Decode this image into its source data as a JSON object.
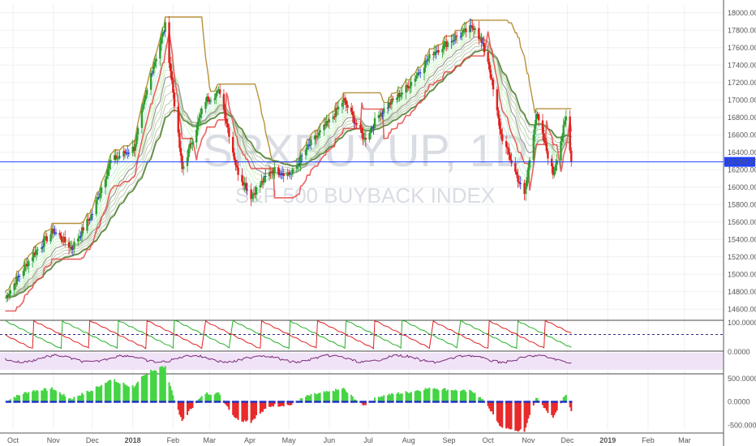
{
  "watermark": {
    "symbol": "SPXBUYUP, 1D",
    "name": "S&P 500 BUYBACK INDEX"
  },
  "colors": {
    "up": "#2e9e2e",
    "down": "#e0201e",
    "neutral": "#1f2fd6",
    "level_line": "#2040ff",
    "gold": "#b8913a",
    "red_trail": "#e84545",
    "ribbon_green": "#3c9a3c",
    "grid": "#eef0f3",
    "panel_border": "#444444"
  },
  "price_axis": {
    "ticks": [
      "18000.00",
      "17800.00",
      "17600.00",
      "17400.00",
      "17200.00",
      "17000.00",
      "16800.00",
      "16600.00",
      "16400.00",
      "16200.00",
      "16000.00",
      "15800.00",
      "15600.00",
      "15400.00",
      "15200.00",
      "15000.00",
      "14800.00",
      "14600.00"
    ],
    "last_price_label": "16289.25"
  },
  "osc1_axis": {
    "ticks": [
      "100.0000"
    ]
  },
  "osc2_axis": {
    "ticks": [
      "0.0000"
    ]
  },
  "osc3_axis": {
    "ticks": [
      "500.0000",
      "0.0000",
      "-500.0000"
    ]
  },
  "time_axis": {
    "labels": [
      "Oct",
      "Nov",
      "Dec",
      "2018",
      "Feb",
      "Mar",
      "Apr",
      "May",
      "Jun",
      "Jul",
      "Aug",
      "Sep",
      "Oct",
      "Nov",
      "Dec",
      "2019",
      "Feb",
      "Mar"
    ]
  },
  "chart_data": {
    "type": "candlestick",
    "title": "SPXBUYUP, 1D",
    "subtitle": "S&P 500 BUYBACK INDEX",
    "last_price": 16289.25,
    "ylim": [
      14500,
      18100
    ],
    "series": [
      {
        "name": "",
        "ohlc_keypoints": [
          [
            "2017-09-25",
            14730
          ],
          [
            "2017-10-15",
            15200
          ],
          [
            "2017-11-01",
            15500
          ],
          [
            "2017-11-15",
            15300
          ],
          [
            "2017-12-01",
            15700
          ],
          [
            "2017-12-15",
            16300
          ],
          [
            "2018-01-02",
            16450
          ],
          [
            "2018-01-15",
            17300
          ],
          [
            "2018-01-26",
            17850
          ],
          [
            "2018-02-08",
            16200
          ],
          [
            "2018-02-26",
            17000
          ],
          [
            "2018-03-09",
            17100
          ],
          [
            "2018-03-22",
            16200
          ],
          [
            "2018-04-02",
            15900
          ],
          [
            "2018-04-18",
            16200
          ],
          [
            "2018-05-03",
            16150
          ],
          [
            "2018-05-15",
            16450
          ],
          [
            "2018-06-01",
            16750
          ],
          [
            "2018-06-12",
            17000
          ],
          [
            "2018-06-28",
            16550
          ],
          [
            "2018-07-10",
            16850
          ],
          [
            "2018-07-31",
            17150
          ],
          [
            "2018-08-20",
            17550
          ],
          [
            "2018-09-04",
            17700
          ],
          [
            "2018-09-21",
            17850
          ],
          [
            "2018-10-01",
            17450
          ],
          [
            "2018-10-11",
            16600
          ],
          [
            "2018-10-29",
            15900
          ],
          [
            "2018-11-07",
            16850
          ],
          [
            "2018-11-20",
            16150
          ],
          [
            "2018-11-30",
            16800
          ],
          [
            "2018-12-04",
            16289
          ]
        ]
      }
    ],
    "oscillator_ranges": {
      "osc1": [
        0,
        100
      ],
      "osc2": [
        -50,
        50
      ],
      "osc3": [
        -600,
        600
      ]
    }
  }
}
